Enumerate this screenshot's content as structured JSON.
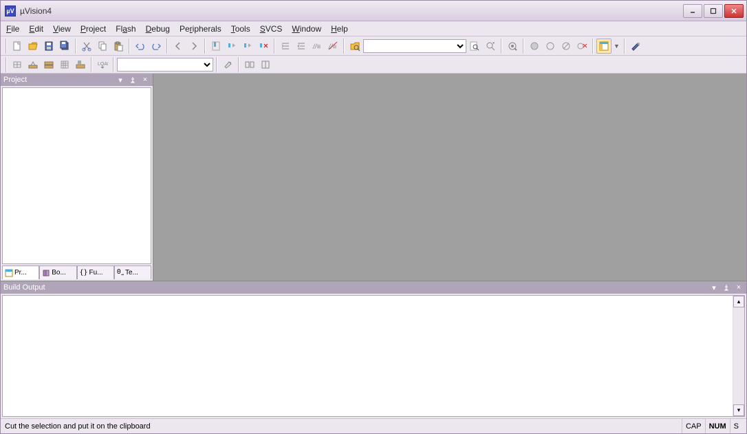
{
  "titlebar": {
    "title": "µVision4"
  },
  "menu": {
    "file": "File",
    "edit": "Edit",
    "view": "View",
    "project": "Project",
    "flash": "Flash",
    "debug": "Debug",
    "peripherals": "Peripherals",
    "tools": "Tools",
    "svcs": "SVCS",
    "window": "Window",
    "help": "Help"
  },
  "toolbar": {
    "icons": {
      "new": "new-icon",
      "open": "open-icon",
      "save": "save-icon",
      "saveall": "save-all-icon",
      "cut": "cut-icon",
      "copy": "copy-icon",
      "paste": "paste-icon",
      "undo": "undo-icon",
      "redo": "redo-icon",
      "back": "nav-back-icon",
      "forward": "nav-forward-icon",
      "bookmark": "bookmark-icon",
      "bkprev": "bookmark-prev-icon",
      "bknext": "bookmark-next-icon",
      "bkclear": "bookmark-clear-icon",
      "indent": "indent-icon",
      "outdent": "outdent-icon",
      "comment": "comment-icon",
      "uncomment": "uncomment-icon",
      "findfiles": "find-in-files-icon",
      "find": "find-icon",
      "replace": "replace-icon",
      "search": "search-icon",
      "debug": "debug-icon",
      "bp": "breakpoint-icon",
      "bpdis": "breakpoint-disable-icon",
      "bpkill": "breakpoint-kill-icon",
      "winconfig": "window-config-icon",
      "config": "config-icon"
    },
    "search_value": ""
  },
  "toolbar2": {
    "icons": {
      "translate": "translate-icon",
      "build": "build-icon",
      "rebuild": "rebuild-icon",
      "batch": "batch-build-icon",
      "stop": "stop-build-icon",
      "download": "download-icon"
    },
    "target_value": "",
    "icons2": {
      "options": "options-icon",
      "manage": "manage-icon",
      "filext": "file-ext-icon"
    }
  },
  "project_panel": {
    "title": "Project",
    "tabs": {
      "project": "Pr...",
      "books": "Bo...",
      "functions": "Fu...",
      "templates": "Te..."
    }
  },
  "build_panel": {
    "title": "Build Output",
    "content": ""
  },
  "statusbar": {
    "text": "Cut the selection and put it on the clipboard",
    "cap": "CAP",
    "num": "NUM",
    "scrl": "S"
  }
}
